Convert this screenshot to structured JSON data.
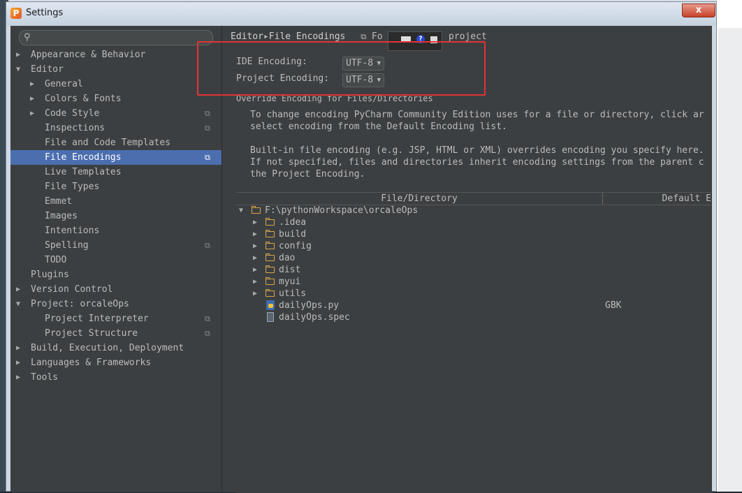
{
  "window": {
    "title": "Settings",
    "close_label": "x"
  },
  "sidebar": {
    "search_placeholder": "",
    "items": [
      {
        "label": "Appearance & Behavior"
      },
      {
        "label": "Editor"
      },
      {
        "label": "General"
      },
      {
        "label": "Colors & Fonts"
      },
      {
        "label": "Code Style"
      },
      {
        "label": "Inspections"
      },
      {
        "label": "File and Code Templates"
      },
      {
        "label": "File Encodings"
      },
      {
        "label": "Live Templates"
      },
      {
        "label": "File Types"
      },
      {
        "label": "Emmet"
      },
      {
        "label": "Images"
      },
      {
        "label": "Intentions"
      },
      {
        "label": "Spelling"
      },
      {
        "label": "TODO"
      },
      {
        "label": "Plugins"
      },
      {
        "label": "Version Control"
      },
      {
        "label": "Project: orcaleOps"
      },
      {
        "label": "Project Interpreter"
      },
      {
        "label": "Project Structure"
      },
      {
        "label": "Build, Execution, Deployment"
      },
      {
        "label": "Languages & Frameworks"
      },
      {
        "label": "Tools"
      }
    ]
  },
  "breadcrumb": {
    "parent": "Editor",
    "current": "File Encodings",
    "scope_prefix": "Fo",
    "scope": "project"
  },
  "encoding": {
    "ide_label": "IDE Encoding:",
    "ide_value": "UTF-8",
    "project_label": "Project Encoding:",
    "project_value": "UTF-8",
    "override_label": "Override Encoding for Files/Directories"
  },
  "description": {
    "line1": "To change encoding PyCharm Community Edition uses for a file or directory, click ar",
    "line2": "select encoding from the Default Encoding list.",
    "line3": "Built-in file encoding (e.g. JSP, HTML or XML) overrides encoding you specify here.",
    "line4": "If not specified, files and directories inherit encoding settings from the parent c",
    "line5": "the Project Encoding."
  },
  "table": {
    "col_file": "File/Directory",
    "col_encoding": "Default E",
    "root": "F:\\pythonWorkspace\\orcaleOps",
    "rows": [
      {
        "name": ".idea",
        "encoding": ""
      },
      {
        "name": "build",
        "encoding": ""
      },
      {
        "name": "config",
        "encoding": ""
      },
      {
        "name": "dao",
        "encoding": ""
      },
      {
        "name": "dist",
        "encoding": ""
      },
      {
        "name": "myui",
        "encoding": ""
      },
      {
        "name": "utils",
        "encoding": ""
      },
      {
        "name": "dailyOps.py",
        "encoding": "GBK"
      },
      {
        "name": "dailyOps.spec",
        "encoding": ""
      }
    ]
  }
}
